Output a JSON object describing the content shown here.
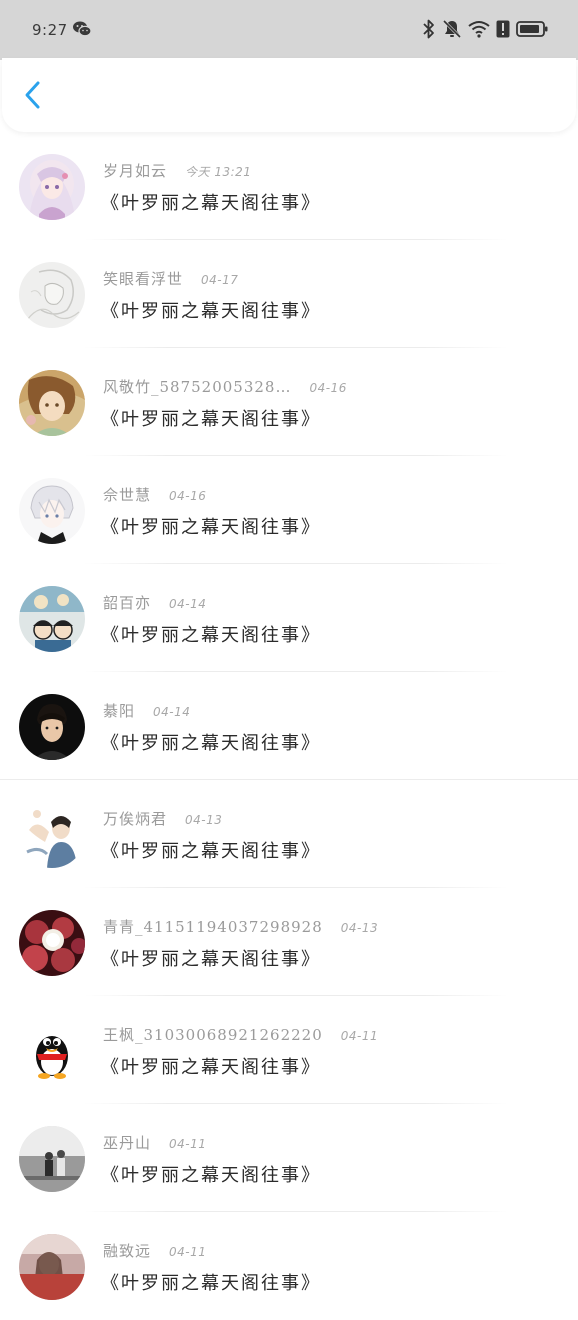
{
  "status_bar": {
    "time": "9:27",
    "icons": [
      "wechat-icon",
      "bluetooth-icon",
      "bell-muted-icon",
      "wifi-icon",
      "alert-icon",
      "battery-icon"
    ]
  },
  "header": {
    "back_icon": "chevron-left-icon",
    "accent_color": "#2aa2ec"
  },
  "items": [
    {
      "username": "岁月如云",
      "date": "今天 13:21",
      "content": "《叶罗丽之幕天阁往事》",
      "avatar": "anime-girl-avatar"
    },
    {
      "username": "笑眼看浮世",
      "date": "04-17",
      "content": "《叶罗丽之幕天阁往事》",
      "avatar": "sketch-avatar"
    },
    {
      "username": "风敬竹_58752005328…",
      "date": "04-16",
      "content": "《叶罗丽之幕天阁往事》",
      "avatar": "anime-painting-avatar"
    },
    {
      "username": "佘世慧",
      "date": "04-16",
      "content": "《叶罗丽之幕天阁往事》",
      "avatar": "white-hair-anime-avatar"
    },
    {
      "username": "韶百亦",
      "date": "04-14",
      "content": "《叶罗丽之幕天阁往事》",
      "avatar": "cartoon-group-avatar"
    },
    {
      "username": "綦阳",
      "date": "04-14",
      "content": "《叶罗丽之幕天阁往事》",
      "avatar": "person-photo-avatar"
    },
    {
      "username": "万俟炳君",
      "date": "04-13",
      "content": "《叶罗丽之幕天阁往事》",
      "avatar": "drawing-avatar"
    },
    {
      "username": "青青_41151194037298928",
      "date": "04-13",
      "content": "《叶罗丽之幕天阁往事》",
      "avatar": "lychee-avatar"
    },
    {
      "username": "王枫_31030068921262220",
      "date": "04-11",
      "content": "《叶罗丽之幕天阁往事》",
      "avatar": "qq-penguin-avatar"
    },
    {
      "username": "巫丹山",
      "date": "04-11",
      "content": "《叶罗丽之幕天阁往事》",
      "avatar": "couple-photo-avatar"
    },
    {
      "username": "融致远",
      "date": "04-11",
      "content": "《叶罗丽之幕天阁往事》",
      "avatar": "photo-avatar"
    }
  ]
}
